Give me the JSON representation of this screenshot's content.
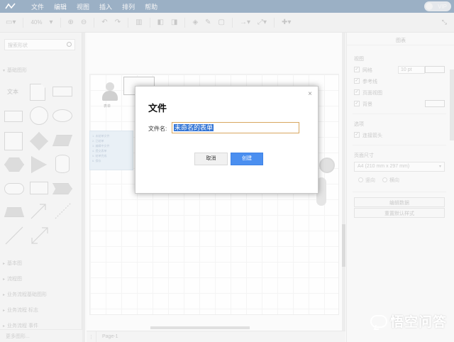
{
  "menubar": {
    "items": [
      "文件",
      "编辑",
      "视图",
      "插入",
      "排列",
      "帮助"
    ],
    "vip_label": "VIP"
  },
  "toolbar": {
    "zoom": "40%"
  },
  "sidebar": {
    "search_placeholder": "搜索形状",
    "section_basic": "基础图形",
    "text_shape_label": "文本",
    "sections": [
      "基本图",
      "流程图",
      "业务流程基础图形",
      "业务流程 标志",
      "业务流程 事件"
    ],
    "footer": "更多图形..."
  },
  "canvas": {
    "person_label": "表单",
    "note_lines": [
      "1. 未结单文件",
      "2. 已结单",
      "3. 编辑中文件",
      "4. 提交表单",
      "5. 结单完成",
      "6. 保存"
    ]
  },
  "pagebar": {
    "page_tab": "Page-1"
  },
  "right_panel": {
    "title": "图表",
    "view_label": "视图",
    "view_items": [
      {
        "label": "网格",
        "checked": true
      },
      {
        "label": "参考线",
        "checked": true
      },
      {
        "label": "页面视图",
        "checked": true
      },
      {
        "label": "背景",
        "checked": true
      }
    ],
    "grid_size": "10 pt",
    "options_label": "选项",
    "connection_arrows": "连接箭头",
    "paper_size_label": "页面尺寸",
    "paper_size_value": "A4 (210 mm x 297 mm)",
    "orientation_portrait": "竖向",
    "orientation_landscape": "横向",
    "edit_data_button": "编辑数据",
    "reset_style_button": "重置默认样式"
  },
  "watermark": {
    "text": "悟空问答"
  },
  "dialog": {
    "title": "文件",
    "filename_label": "文件名:",
    "filename_value": "未命名的表单",
    "cancel_label": "取消",
    "create_label": "创建",
    "close_glyph": "×"
  },
  "colors": {
    "menubar_bg": "#4a6f96",
    "create_button_bg": "#4b8ff0",
    "input_focus_border": "#d8a760",
    "selection_bg": "#3475d5"
  }
}
